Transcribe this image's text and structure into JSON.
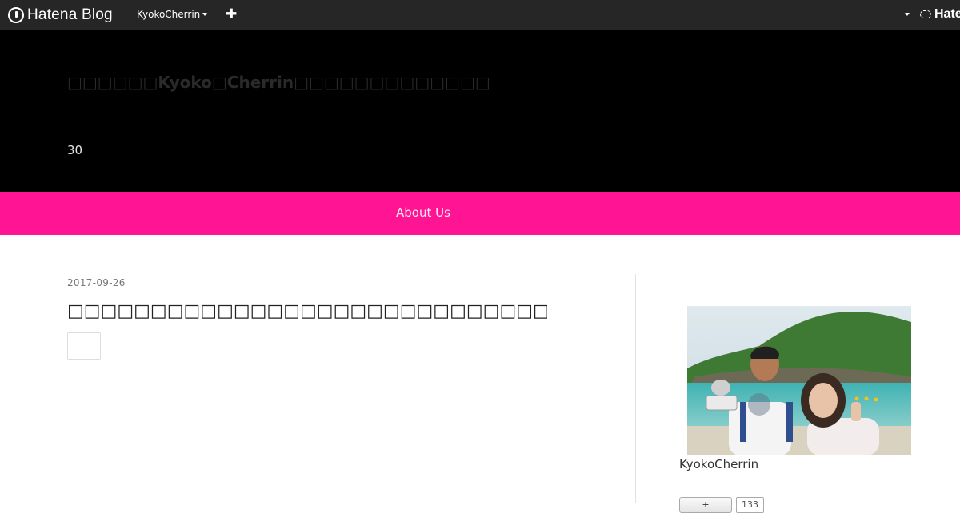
{
  "globalbar": {
    "logo_text": "Hatena Blog",
    "user_name": "KyokoCherrin",
    "add_symbol": "✚",
    "right_text": "Hatena"
  },
  "blog": {
    "title": "□□□□□□Kyoko□Cherrin□□□□□□□□□□□□□",
    "description": "30"
  },
  "nav": {
    "items": [
      {
        "label": "About Us"
      }
    ]
  },
  "entry": {
    "date": "2017-09-26",
    "title": "□□□□□□□□□□□□□□□□□□□□□□□□□□□□□□□□□□□□□□□□"
  },
  "sidebar": {
    "profile_name": "KyokoCherrin",
    "follow_label": "+",
    "follow_count": "133"
  },
  "colors": {
    "topbar": "#262626",
    "header": "#000000",
    "nav": "#ff1493"
  }
}
